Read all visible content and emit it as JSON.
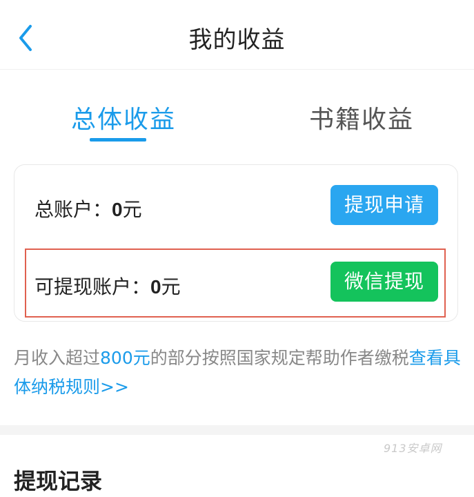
{
  "header": {
    "title": "我的收益",
    "back_icon": "chevron-left-icon"
  },
  "tabs": [
    {
      "label": "总体收益",
      "active": true
    },
    {
      "label": "书籍收益",
      "active": false
    }
  ],
  "accounts": {
    "total": {
      "label": "总账户：",
      "amount": "0",
      "unit": "元",
      "button": "提现申请"
    },
    "withdrawable": {
      "label": "可提现账户：",
      "amount": "0",
      "unit": "元",
      "button": "微信提现"
    }
  },
  "notice": {
    "part1": "月收入超过",
    "highlight": "800元",
    "part2": "的部分按照国家规定帮助作者缴税",
    "link": "查看具体纳税规则>>"
  },
  "watermark": "913安卓网",
  "records": {
    "title": "提现记录"
  },
  "colors": {
    "accent": "#1a9bea",
    "apply_button": "#2aa6f0",
    "wechat_button": "#14c35c",
    "highlight_border": "#e0604f"
  }
}
